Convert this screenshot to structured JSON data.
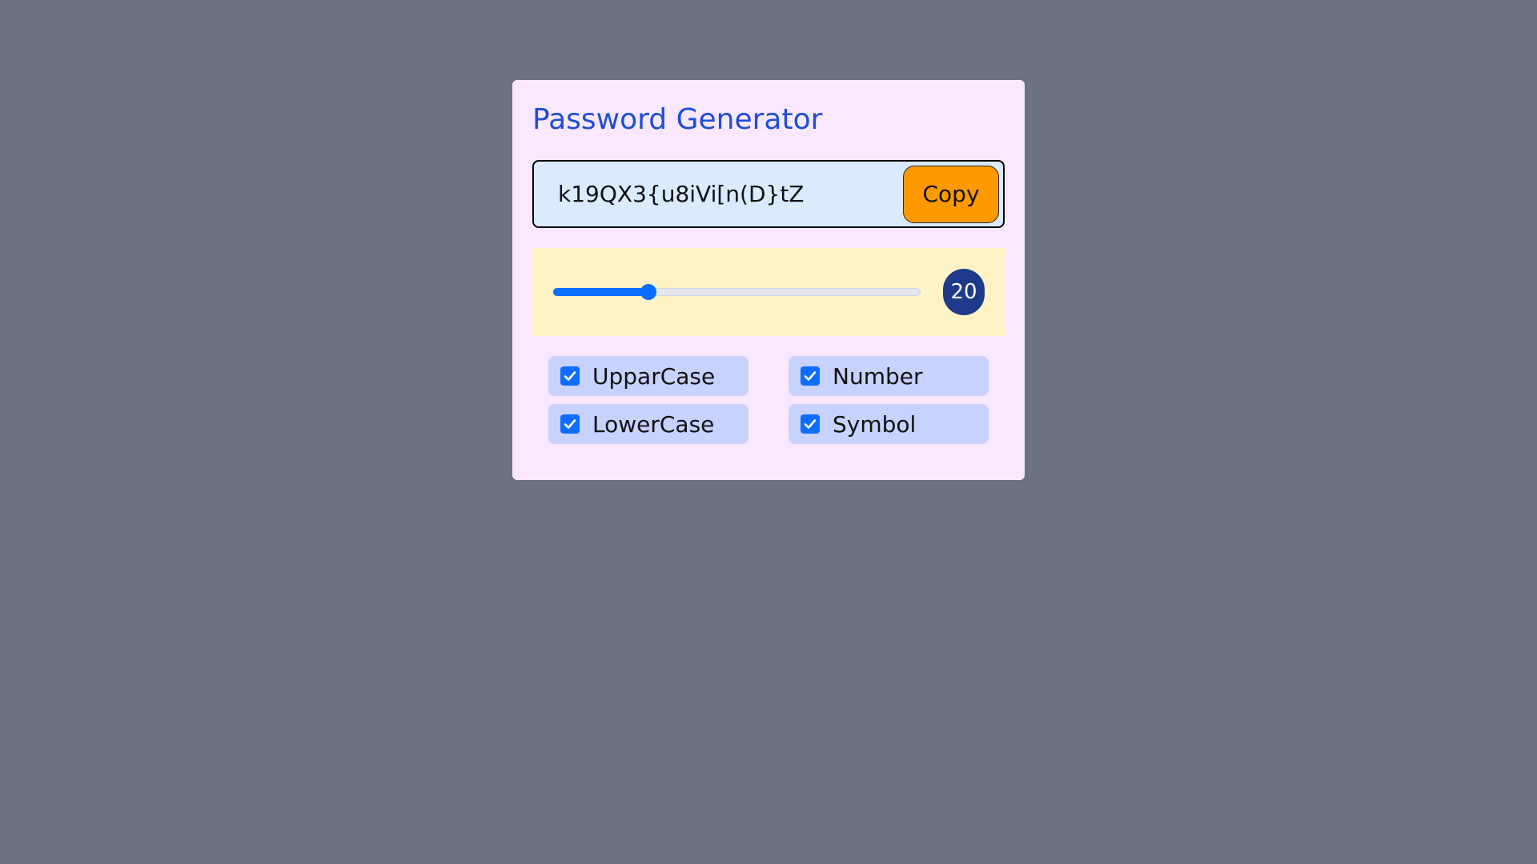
{
  "app": {
    "title": "Password Generator"
  },
  "password": {
    "value": "k19QX3{u8iVi[n(D}tZ",
    "copy_label": "Copy"
  },
  "length": {
    "value": "20",
    "slider_fraction": 0.26
  },
  "options": [
    {
      "label": "UpparCase",
      "checked": true
    },
    {
      "label": "Number",
      "checked": true
    },
    {
      "label": "LowerCase",
      "checked": true
    },
    {
      "label": "Symbol",
      "checked": true
    }
  ],
  "colors": {
    "background": "#6b7280",
    "card": "#fae8ff",
    "title": "#1d4ed8",
    "password_field": "#dbeafe",
    "copy_button": "#ff9900",
    "length_panel": "#fef3c7",
    "accent": "#0d6efd",
    "badge": "#1e3a8a",
    "option_bg": "#c7d2fe"
  },
  "icons": {
    "checkbox": "check-icon"
  }
}
